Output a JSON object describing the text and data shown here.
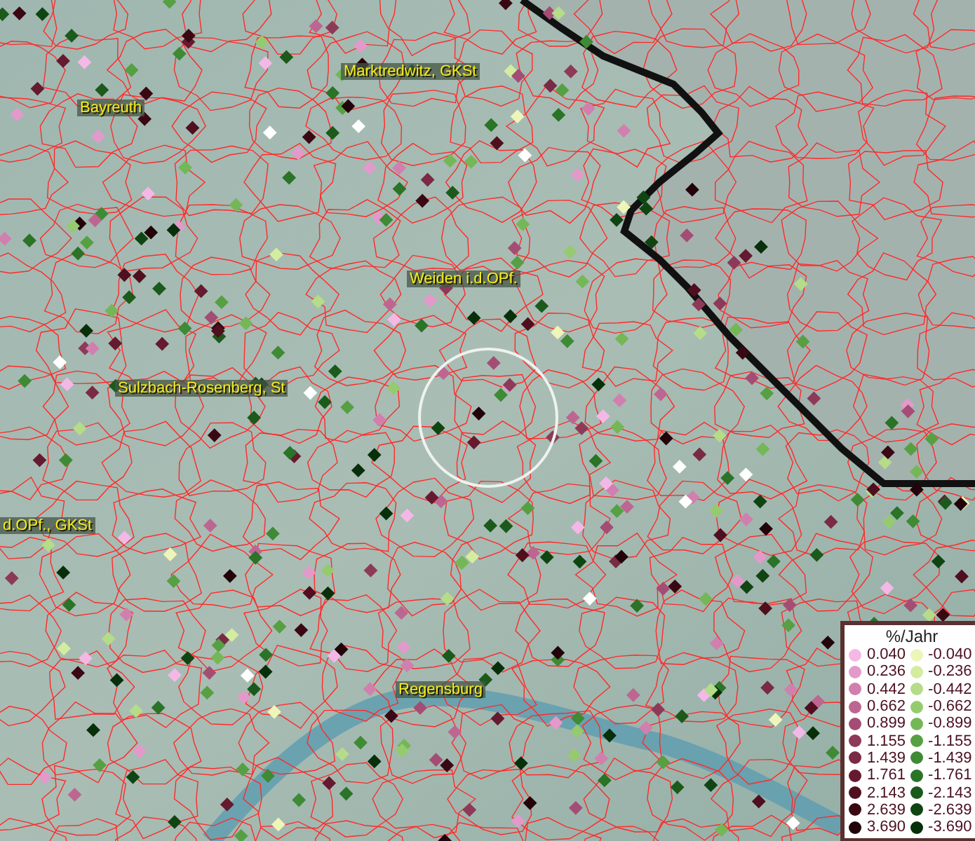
{
  "map": {
    "places": [
      {
        "name": "Marktredwitz, GKSt"
      },
      {
        "name": "Bayreuth"
      },
      {
        "name": "Weiden i.d.OPf."
      },
      {
        "name": "Sulzbach-Rosenberg, St"
      },
      {
        "name": "d.OPf., GKSt"
      },
      {
        "name": "Regensburg"
      }
    ]
  },
  "legend": {
    "title": "%/Jahr",
    "columns": [
      [
        {
          "value": "0.040",
          "color": "#f4b8e6"
        },
        {
          "value": "0.236",
          "color": "#e39acb"
        },
        {
          "value": "0.442",
          "color": "#d17fae"
        },
        {
          "value": "0.662",
          "color": "#bd6691"
        },
        {
          "value": "0.899",
          "color": "#a44d74"
        },
        {
          "value": "1.155",
          "color": "#8c3a58"
        },
        {
          "value": "1.439",
          "color": "#792a44"
        },
        {
          "value": "1.761",
          "color": "#651a30"
        },
        {
          "value": "2.143",
          "color": "#4f0f1f"
        },
        {
          "value": "2.639",
          "color": "#3a0813"
        },
        {
          "value": "3.690",
          "color": "#22030a"
        }
      ],
      [
        {
          "value": "-0.040",
          "color": "#eef5b8"
        },
        {
          "value": "-0.236",
          "color": "#d3eca0"
        },
        {
          "value": "-0.442",
          "color": "#b5dc88"
        },
        {
          "value": "-0.662",
          "color": "#95cb6e"
        },
        {
          "value": "-0.899",
          "color": "#74b757"
        },
        {
          "value": "-1.155",
          "color": "#56a043"
        },
        {
          "value": "-1.439",
          "color": "#3f8a34"
        },
        {
          "value": "-1.761",
          "color": "#2a7327"
        },
        {
          "value": "-2.143",
          "color": "#1b5a1b"
        },
        {
          "value": "-2.639",
          "color": "#0f4512"
        },
        {
          "value": "-3.690",
          "color": "#07300a"
        }
      ]
    ]
  }
}
